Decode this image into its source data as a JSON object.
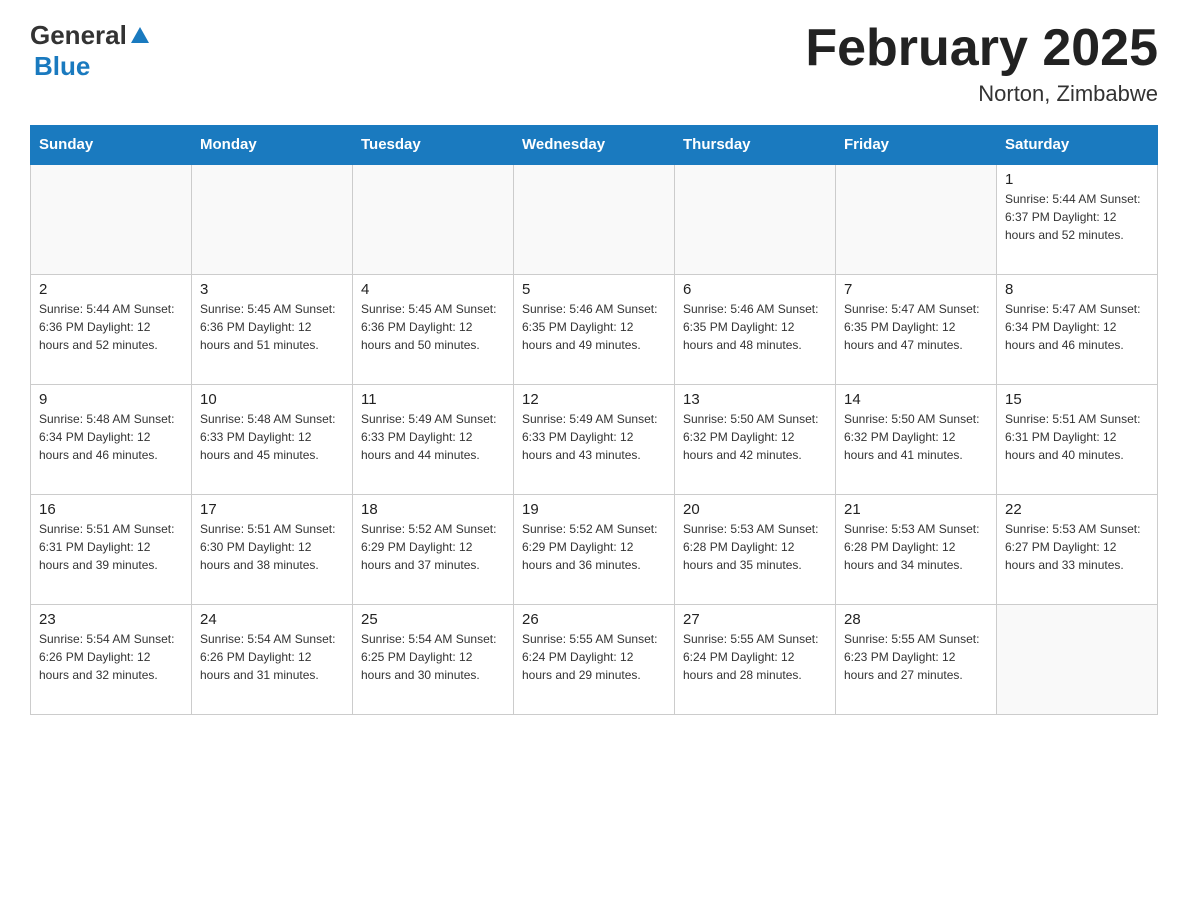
{
  "header": {
    "logo_general": "General",
    "logo_blue": "Blue",
    "title": "February 2025",
    "subtitle": "Norton, Zimbabwe"
  },
  "days_of_week": [
    "Sunday",
    "Monday",
    "Tuesday",
    "Wednesday",
    "Thursday",
    "Friday",
    "Saturday"
  ],
  "weeks": [
    [
      {
        "day": "",
        "info": ""
      },
      {
        "day": "",
        "info": ""
      },
      {
        "day": "",
        "info": ""
      },
      {
        "day": "",
        "info": ""
      },
      {
        "day": "",
        "info": ""
      },
      {
        "day": "",
        "info": ""
      },
      {
        "day": "1",
        "info": "Sunrise: 5:44 AM\nSunset: 6:37 PM\nDaylight: 12 hours\nand 52 minutes."
      }
    ],
    [
      {
        "day": "2",
        "info": "Sunrise: 5:44 AM\nSunset: 6:36 PM\nDaylight: 12 hours\nand 52 minutes."
      },
      {
        "day": "3",
        "info": "Sunrise: 5:45 AM\nSunset: 6:36 PM\nDaylight: 12 hours\nand 51 minutes."
      },
      {
        "day": "4",
        "info": "Sunrise: 5:45 AM\nSunset: 6:36 PM\nDaylight: 12 hours\nand 50 minutes."
      },
      {
        "day": "5",
        "info": "Sunrise: 5:46 AM\nSunset: 6:35 PM\nDaylight: 12 hours\nand 49 minutes."
      },
      {
        "day": "6",
        "info": "Sunrise: 5:46 AM\nSunset: 6:35 PM\nDaylight: 12 hours\nand 48 minutes."
      },
      {
        "day": "7",
        "info": "Sunrise: 5:47 AM\nSunset: 6:35 PM\nDaylight: 12 hours\nand 47 minutes."
      },
      {
        "day": "8",
        "info": "Sunrise: 5:47 AM\nSunset: 6:34 PM\nDaylight: 12 hours\nand 46 minutes."
      }
    ],
    [
      {
        "day": "9",
        "info": "Sunrise: 5:48 AM\nSunset: 6:34 PM\nDaylight: 12 hours\nand 46 minutes."
      },
      {
        "day": "10",
        "info": "Sunrise: 5:48 AM\nSunset: 6:33 PM\nDaylight: 12 hours\nand 45 minutes."
      },
      {
        "day": "11",
        "info": "Sunrise: 5:49 AM\nSunset: 6:33 PM\nDaylight: 12 hours\nand 44 minutes."
      },
      {
        "day": "12",
        "info": "Sunrise: 5:49 AM\nSunset: 6:33 PM\nDaylight: 12 hours\nand 43 minutes."
      },
      {
        "day": "13",
        "info": "Sunrise: 5:50 AM\nSunset: 6:32 PM\nDaylight: 12 hours\nand 42 minutes."
      },
      {
        "day": "14",
        "info": "Sunrise: 5:50 AM\nSunset: 6:32 PM\nDaylight: 12 hours\nand 41 minutes."
      },
      {
        "day": "15",
        "info": "Sunrise: 5:51 AM\nSunset: 6:31 PM\nDaylight: 12 hours\nand 40 minutes."
      }
    ],
    [
      {
        "day": "16",
        "info": "Sunrise: 5:51 AM\nSunset: 6:31 PM\nDaylight: 12 hours\nand 39 minutes."
      },
      {
        "day": "17",
        "info": "Sunrise: 5:51 AM\nSunset: 6:30 PM\nDaylight: 12 hours\nand 38 minutes."
      },
      {
        "day": "18",
        "info": "Sunrise: 5:52 AM\nSunset: 6:29 PM\nDaylight: 12 hours\nand 37 minutes."
      },
      {
        "day": "19",
        "info": "Sunrise: 5:52 AM\nSunset: 6:29 PM\nDaylight: 12 hours\nand 36 minutes."
      },
      {
        "day": "20",
        "info": "Sunrise: 5:53 AM\nSunset: 6:28 PM\nDaylight: 12 hours\nand 35 minutes."
      },
      {
        "day": "21",
        "info": "Sunrise: 5:53 AM\nSunset: 6:28 PM\nDaylight: 12 hours\nand 34 minutes."
      },
      {
        "day": "22",
        "info": "Sunrise: 5:53 AM\nSunset: 6:27 PM\nDaylight: 12 hours\nand 33 minutes."
      }
    ],
    [
      {
        "day": "23",
        "info": "Sunrise: 5:54 AM\nSunset: 6:26 PM\nDaylight: 12 hours\nand 32 minutes."
      },
      {
        "day": "24",
        "info": "Sunrise: 5:54 AM\nSunset: 6:26 PM\nDaylight: 12 hours\nand 31 minutes."
      },
      {
        "day": "25",
        "info": "Sunrise: 5:54 AM\nSunset: 6:25 PM\nDaylight: 12 hours\nand 30 minutes."
      },
      {
        "day": "26",
        "info": "Sunrise: 5:55 AM\nSunset: 6:24 PM\nDaylight: 12 hours\nand 29 minutes."
      },
      {
        "day": "27",
        "info": "Sunrise: 5:55 AM\nSunset: 6:24 PM\nDaylight: 12 hours\nand 28 minutes."
      },
      {
        "day": "28",
        "info": "Sunrise: 5:55 AM\nSunset: 6:23 PM\nDaylight: 12 hours\nand 27 minutes."
      },
      {
        "day": "",
        "info": ""
      }
    ]
  ]
}
